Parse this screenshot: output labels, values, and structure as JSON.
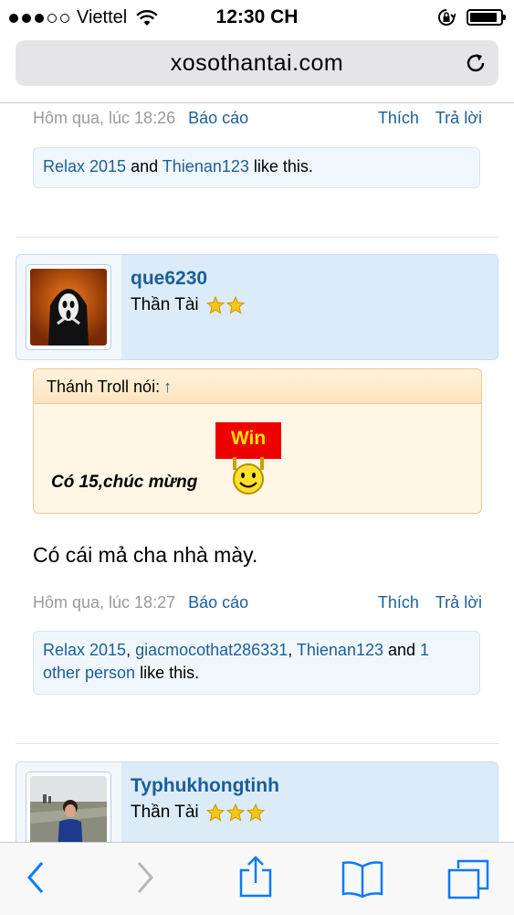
{
  "status_bar": {
    "carrier": "Viettel",
    "time": "12:30 CH",
    "battery_level": 0.9
  },
  "browser": {
    "url": "xosothantai.com"
  },
  "post1": {
    "date": "Hôm qua, lúc 18:26",
    "report": "Báo cáo",
    "like": "Thích",
    "reply": "Trả lời",
    "likes": {
      "user1": "Relax 2015",
      "and": " and ",
      "user2": "Thienan123",
      "suffix": " like this."
    }
  },
  "post2": {
    "username": "que6230",
    "user_title": "Thần Tài",
    "stars": 2,
    "quote": {
      "author": "Thánh Troll nói:",
      "arrow": "↑",
      "text": "Có 15,chúc mừng",
      "sign": "Win"
    },
    "message": "Có cái mả cha nhà mày.",
    "date": "Hôm qua, lúc 18:27",
    "report": "Báo cáo",
    "like": "Thích",
    "reply": "Trả lời",
    "likes": {
      "user1": "Relax 2015",
      "sep1": ", ",
      "user2": "giacmocothat286331",
      "sep2": ", ",
      "user3": "Thienan123",
      "and": " and ",
      "other_a": "1",
      "other_b": "other person",
      "suffix": " like this."
    }
  },
  "post3": {
    "username": "Typhukhongtinh",
    "user_title": "Thần Tài",
    "stars": 3
  },
  "colors": {
    "link": "#1b5e99",
    "userbox": "#dcebf8",
    "quote_border": "#f2c690",
    "ios_blue": "#0a7aff"
  },
  "icons": [
    "wifi-icon",
    "orientation-lock-icon",
    "battery-icon",
    "reload-icon",
    "star-icon",
    "smiley-icon",
    "back-icon",
    "forward-icon",
    "share-icon",
    "bookmarks-icon",
    "tabs-icon"
  ]
}
